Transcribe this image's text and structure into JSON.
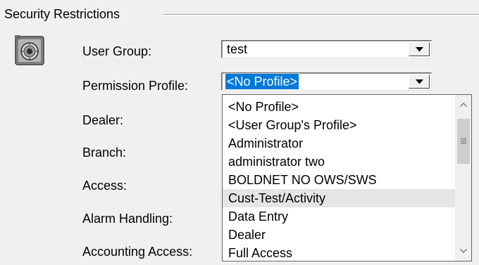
{
  "group": {
    "title": "Security Restrictions"
  },
  "icons": {
    "safe": "safe-icon",
    "combo_arrow": "chevron-down-icon",
    "scroll_up": "chevron-up-icon",
    "scroll_down": "chevron-down-icon",
    "scroll_grip": "grip-icon"
  },
  "fields": {
    "user_group": {
      "label": "User Group:",
      "value": "test"
    },
    "permission_profile": {
      "label": "Permission Profile:",
      "value": "<No Profile>"
    },
    "dealer": {
      "label": "Dealer:"
    },
    "branch": {
      "label": "Branch:"
    },
    "access": {
      "label": "Access:"
    },
    "alarm_handling": {
      "label": "Alarm Handling:"
    },
    "accounting_access": {
      "label": "Accounting Access:"
    }
  },
  "dropdown": {
    "items": [
      "<No Profile>",
      "<User Group's Profile>",
      "Administrator",
      "administrator two",
      "BOLDNET NO OWS/SWS",
      "Cust-Test/Activity",
      "Data Entry",
      "Dealer",
      "Full Access"
    ],
    "hovered_item": "Cust-Test/Activity"
  },
  "colors": {
    "selection": "#0078d7",
    "hover": "#e5e5e5",
    "window_bg": "#f0f0f0"
  }
}
